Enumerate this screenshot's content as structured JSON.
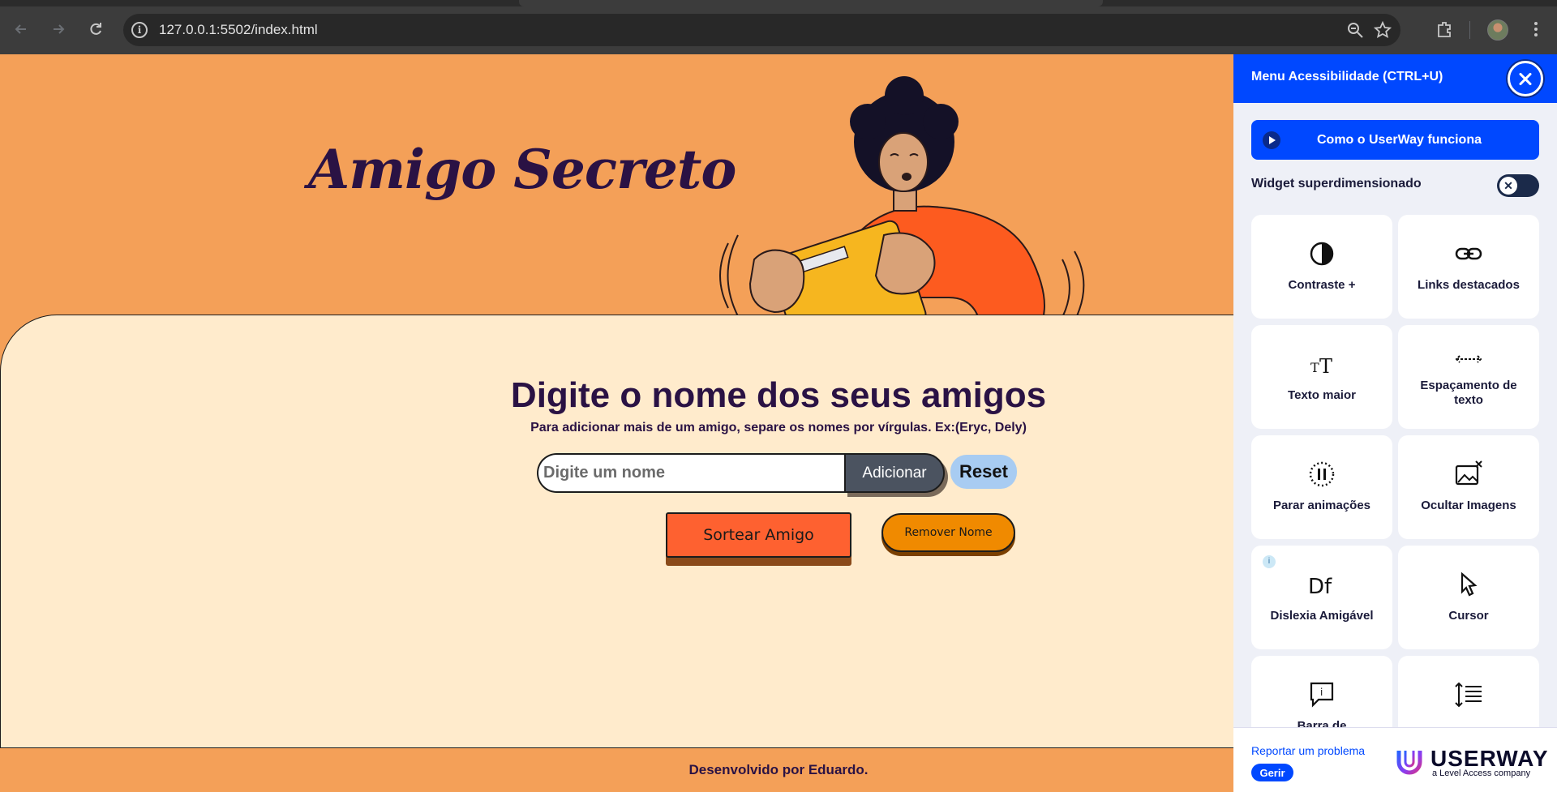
{
  "browser": {
    "url": "127.0.0.1:5502/index.html"
  },
  "page": {
    "hero_title": "Amigo Secreto",
    "section_title": "Digite o nome dos seus amigos",
    "subtitle": "Para adicionar mais de um amigo, separe os nomes por vírgulas. Ex:(Eryc, Dely)",
    "input_placeholder": "Digite um nome",
    "add_label": "Adicionar",
    "reset_label": "Reset",
    "draw_label": "Sortear Amigo",
    "remove_label": "Remover Nome",
    "footer_text": "Desenvolvido por Eduardo."
  },
  "a11y": {
    "title": "Menu Acessibilidade (CTRL+U)",
    "how_label": "Como o UserWay funciona",
    "oversize_label": "Widget superdimensionado",
    "oversize_enabled": false,
    "tiles": [
      {
        "label": "Contraste +",
        "icon": "contrast-icon"
      },
      {
        "label": "Links destacados",
        "icon": "link-icon"
      },
      {
        "label": "Texto maior",
        "icon": "text-size-icon"
      },
      {
        "label": "Espaçamento de texto",
        "icon": "text-spacing-icon"
      },
      {
        "label": "Parar animações",
        "icon": "pause-animation-icon"
      },
      {
        "label": "Ocultar Imagens",
        "icon": "hide-images-icon"
      },
      {
        "label": "Dislexia Amigável",
        "icon": "dyslexia-icon"
      },
      {
        "label": "Cursor",
        "icon": "cursor-icon"
      },
      {
        "label": "Barra de",
        "icon": "tooltip-icon"
      },
      {
        "label": "",
        "icon": "line-height-icon"
      }
    ],
    "dyslexia_badge": "i",
    "report_label": "Reportar um problema",
    "manage_label": "Gerir",
    "brand_word": "USERWAY",
    "brand_sub": "a Level Access company"
  },
  "colors": {
    "page_bg": "#f4a058",
    "card_bg": "#ffebcc",
    "title": "#2a1244",
    "draw_button": "#fe6130",
    "remove_button": "#f08a00",
    "add_button": "#4b5360",
    "reset_button": "#a8ccf2",
    "a11y_blue": "#0048ff"
  }
}
